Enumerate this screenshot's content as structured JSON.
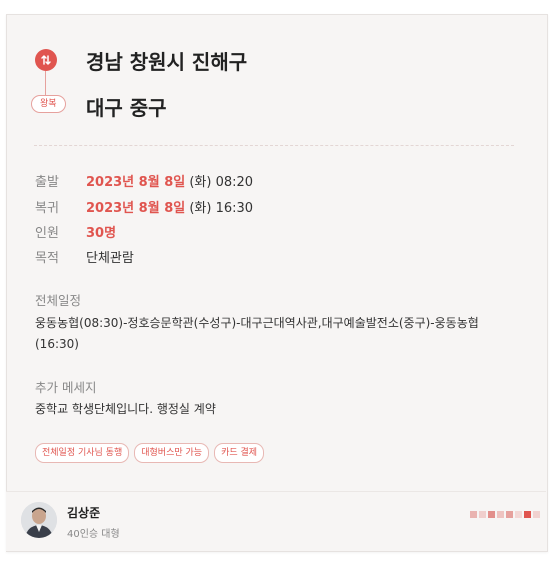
{
  "trip": {
    "type_badge": "왕복",
    "origin": "경남 창원시 진해구",
    "destination": "대구 중구"
  },
  "details": [
    {
      "label": "출발",
      "date": "2023년 8월 8일",
      "rest": " (화) 08:20"
    },
    {
      "label": "복귀",
      "date": "2023년 8월 8일",
      "rest": " (화) 16:30"
    },
    {
      "label": "인원",
      "date": "30명",
      "rest": ""
    },
    {
      "label": "목적",
      "date": "",
      "rest": "단체관람"
    }
  ],
  "itinerary": {
    "title": "전체일정",
    "text": "웅동농협(08:30)-정호승문학관(수성구)-대구근대역사관,대구예술발전소(중구)-웅동농협(16:30)"
  },
  "message": {
    "title": "추가 메세지",
    "text": "중학교 학생단체입니다. 행정실 계약"
  },
  "tags": [
    "전체일정 기사님 동행",
    "대형버스만 가능",
    "카드 결제"
  ],
  "driver": {
    "name": "김상준",
    "info": "40인승 대형"
  },
  "colors": {
    "accent": "#e0554f"
  },
  "icons": {
    "route": "swap-vertical-icon",
    "avatar": "driver-avatar"
  }
}
